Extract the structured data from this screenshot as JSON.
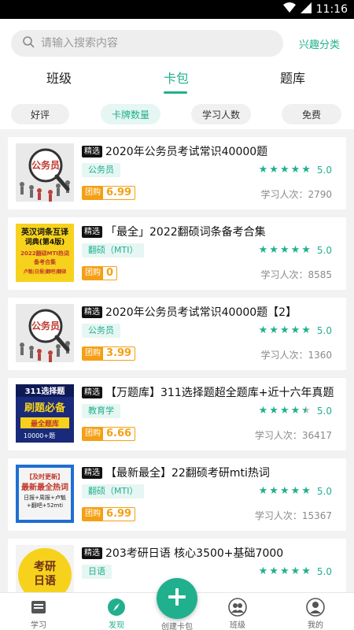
{
  "status": {
    "time": "11:16"
  },
  "search": {
    "placeholder": "请输入搜索内容",
    "interest_label": "兴趣分类"
  },
  "tabs": [
    {
      "label": "班级",
      "active": false
    },
    {
      "label": "卡包",
      "active": true
    },
    {
      "label": "题库",
      "active": false
    }
  ],
  "filters": [
    {
      "label": "好评",
      "active": false
    },
    {
      "label": "卡牌数量",
      "active": true
    },
    {
      "label": "学习人数",
      "active": false
    },
    {
      "label": "免费",
      "active": false
    }
  ],
  "badges": {
    "featured": "精选",
    "group_buy": "团购"
  },
  "cards": [
    {
      "title": "2020年公务员考试常识40000题",
      "category": "公务员",
      "rating": "5.0",
      "stars": 5,
      "price": "6.99",
      "learners": "学习人次：2790",
      "thumb_text": "公务员"
    },
    {
      "title": "「最全」2022翻硕词条备考合集",
      "category": "翻硕（MTI）",
      "rating": "5.0",
      "stars": 5,
      "price": "0",
      "learners": "学习人次：8585",
      "thumb_text": "英汉词条互译词典(第4版)"
    },
    {
      "title": "2020年公务员考试常识40000题【2】",
      "category": "公务员",
      "rating": "5.0",
      "stars": 5,
      "price": "3.99",
      "learners": "学习人次：1360",
      "thumb_text": "公务员"
    },
    {
      "title": "【万题库】311选择题超全题库+近十六年真题",
      "category": "教育学",
      "rating": "5.0",
      "stars": 4.5,
      "price": "6.66",
      "learners": "学习人次：36417",
      "thumb_text": "311选择题 刷题必备"
    },
    {
      "title": "【最新最全】22翻硕考研mti热词",
      "category": "翻硕（MTI）",
      "rating": "5.0",
      "stars": 5,
      "price": "6.99",
      "learners": "学习人次：15367",
      "thumb_text": "最新最全热词"
    },
    {
      "title": "203考研日语 核心3500+基础7000",
      "category": "日语",
      "rating": "5.0",
      "stars": 5,
      "price": "",
      "learners": "",
      "thumb_text": "考研日语"
    }
  ],
  "nav": {
    "study": "学习",
    "discover": "发现",
    "create": "创建卡包",
    "class": "班级",
    "mine": "我的"
  },
  "colors": {
    "accent": "#21b08e",
    "price": "#f4a015"
  }
}
